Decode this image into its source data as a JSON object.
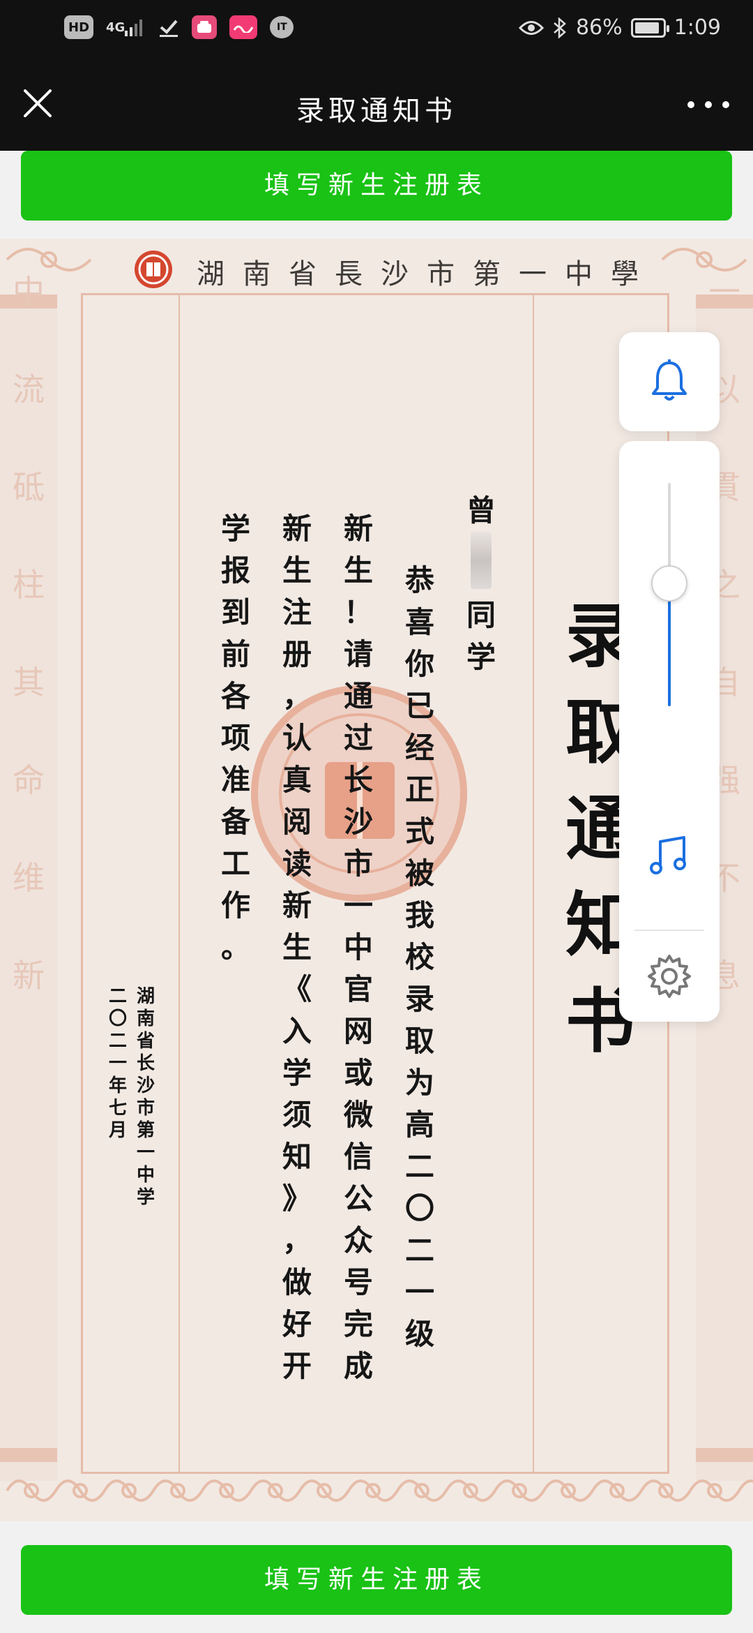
{
  "status_bar": {
    "left_icons": [
      "HD",
      "4G",
      "signal-icon",
      "check-icon",
      "app-icon-pink",
      "app-icon-bilibili",
      "it-icon"
    ],
    "hd": "HD",
    "network": "4G",
    "it": "IT",
    "battery_percent": "86%",
    "battery_level": 0.86,
    "time": "1:09"
  },
  "title_bar": {
    "title": "录取通知书"
  },
  "buttons": {
    "top_label": "填写新生注册表",
    "bottom_label": "填写新生注册表"
  },
  "certificate": {
    "school_name": "湖南省長沙市第一中學",
    "side_left": [
      "中",
      "流",
      "砥",
      "柱",
      "其",
      "命",
      "维",
      "新"
    ],
    "side_right": [
      "一",
      "以",
      "貫",
      "之",
      "自",
      "强",
      "不",
      "息"
    ],
    "title_vertical": "录取通知书",
    "recipient_surname": "曾",
    "recipient_suffix": "同学",
    "body_columns": [
      "恭喜你已经正式被我校录取为高二〇二一级",
      "新生！请通过长沙市一中官网或微信公众号完成",
      "新生注册，认真阅读新生《入学须知》，做好开",
      "学报到前各项准备工作。"
    ],
    "signature_school": "湖南省长沙市第一中学",
    "signature_date": "二〇二一年七月"
  },
  "controls": {
    "volume_level": 0.55,
    "icons": [
      "bell-icon",
      "music-icon",
      "gear-icon"
    ],
    "accent_color": "#1b6fe0"
  }
}
